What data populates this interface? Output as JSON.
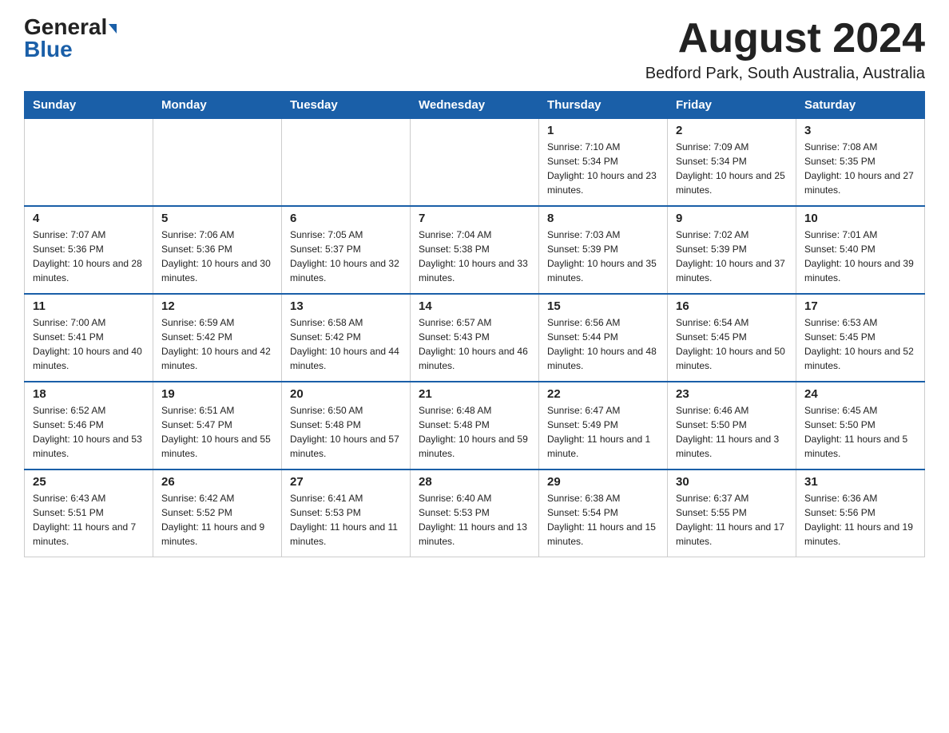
{
  "header": {
    "logo_general": "General",
    "logo_blue": "Blue",
    "month_title": "August 2024",
    "location": "Bedford Park, South Australia, Australia"
  },
  "columns": [
    "Sunday",
    "Monday",
    "Tuesday",
    "Wednesday",
    "Thursday",
    "Friday",
    "Saturday"
  ],
  "weeks": [
    {
      "days": [
        {
          "number": "",
          "info": ""
        },
        {
          "number": "",
          "info": ""
        },
        {
          "number": "",
          "info": ""
        },
        {
          "number": "",
          "info": ""
        },
        {
          "number": "1",
          "info": "Sunrise: 7:10 AM\nSunset: 5:34 PM\nDaylight: 10 hours and 23 minutes."
        },
        {
          "number": "2",
          "info": "Sunrise: 7:09 AM\nSunset: 5:34 PM\nDaylight: 10 hours and 25 minutes."
        },
        {
          "number": "3",
          "info": "Sunrise: 7:08 AM\nSunset: 5:35 PM\nDaylight: 10 hours and 27 minutes."
        }
      ]
    },
    {
      "days": [
        {
          "number": "4",
          "info": "Sunrise: 7:07 AM\nSunset: 5:36 PM\nDaylight: 10 hours and 28 minutes."
        },
        {
          "number": "5",
          "info": "Sunrise: 7:06 AM\nSunset: 5:36 PM\nDaylight: 10 hours and 30 minutes."
        },
        {
          "number": "6",
          "info": "Sunrise: 7:05 AM\nSunset: 5:37 PM\nDaylight: 10 hours and 32 minutes."
        },
        {
          "number": "7",
          "info": "Sunrise: 7:04 AM\nSunset: 5:38 PM\nDaylight: 10 hours and 33 minutes."
        },
        {
          "number": "8",
          "info": "Sunrise: 7:03 AM\nSunset: 5:39 PM\nDaylight: 10 hours and 35 minutes."
        },
        {
          "number": "9",
          "info": "Sunrise: 7:02 AM\nSunset: 5:39 PM\nDaylight: 10 hours and 37 minutes."
        },
        {
          "number": "10",
          "info": "Sunrise: 7:01 AM\nSunset: 5:40 PM\nDaylight: 10 hours and 39 minutes."
        }
      ]
    },
    {
      "days": [
        {
          "number": "11",
          "info": "Sunrise: 7:00 AM\nSunset: 5:41 PM\nDaylight: 10 hours and 40 minutes."
        },
        {
          "number": "12",
          "info": "Sunrise: 6:59 AM\nSunset: 5:42 PM\nDaylight: 10 hours and 42 minutes."
        },
        {
          "number": "13",
          "info": "Sunrise: 6:58 AM\nSunset: 5:42 PM\nDaylight: 10 hours and 44 minutes."
        },
        {
          "number": "14",
          "info": "Sunrise: 6:57 AM\nSunset: 5:43 PM\nDaylight: 10 hours and 46 minutes."
        },
        {
          "number": "15",
          "info": "Sunrise: 6:56 AM\nSunset: 5:44 PM\nDaylight: 10 hours and 48 minutes."
        },
        {
          "number": "16",
          "info": "Sunrise: 6:54 AM\nSunset: 5:45 PM\nDaylight: 10 hours and 50 minutes."
        },
        {
          "number": "17",
          "info": "Sunrise: 6:53 AM\nSunset: 5:45 PM\nDaylight: 10 hours and 52 minutes."
        }
      ]
    },
    {
      "days": [
        {
          "number": "18",
          "info": "Sunrise: 6:52 AM\nSunset: 5:46 PM\nDaylight: 10 hours and 53 minutes."
        },
        {
          "number": "19",
          "info": "Sunrise: 6:51 AM\nSunset: 5:47 PM\nDaylight: 10 hours and 55 minutes."
        },
        {
          "number": "20",
          "info": "Sunrise: 6:50 AM\nSunset: 5:48 PM\nDaylight: 10 hours and 57 minutes."
        },
        {
          "number": "21",
          "info": "Sunrise: 6:48 AM\nSunset: 5:48 PM\nDaylight: 10 hours and 59 minutes."
        },
        {
          "number": "22",
          "info": "Sunrise: 6:47 AM\nSunset: 5:49 PM\nDaylight: 11 hours and 1 minute."
        },
        {
          "number": "23",
          "info": "Sunrise: 6:46 AM\nSunset: 5:50 PM\nDaylight: 11 hours and 3 minutes."
        },
        {
          "number": "24",
          "info": "Sunrise: 6:45 AM\nSunset: 5:50 PM\nDaylight: 11 hours and 5 minutes."
        }
      ]
    },
    {
      "days": [
        {
          "number": "25",
          "info": "Sunrise: 6:43 AM\nSunset: 5:51 PM\nDaylight: 11 hours and 7 minutes."
        },
        {
          "number": "26",
          "info": "Sunrise: 6:42 AM\nSunset: 5:52 PM\nDaylight: 11 hours and 9 minutes."
        },
        {
          "number": "27",
          "info": "Sunrise: 6:41 AM\nSunset: 5:53 PM\nDaylight: 11 hours and 11 minutes."
        },
        {
          "number": "28",
          "info": "Sunrise: 6:40 AM\nSunset: 5:53 PM\nDaylight: 11 hours and 13 minutes."
        },
        {
          "number": "29",
          "info": "Sunrise: 6:38 AM\nSunset: 5:54 PM\nDaylight: 11 hours and 15 minutes."
        },
        {
          "number": "30",
          "info": "Sunrise: 6:37 AM\nSunset: 5:55 PM\nDaylight: 11 hours and 17 minutes."
        },
        {
          "number": "31",
          "info": "Sunrise: 6:36 AM\nSunset: 5:56 PM\nDaylight: 11 hours and 19 minutes."
        }
      ]
    }
  ]
}
